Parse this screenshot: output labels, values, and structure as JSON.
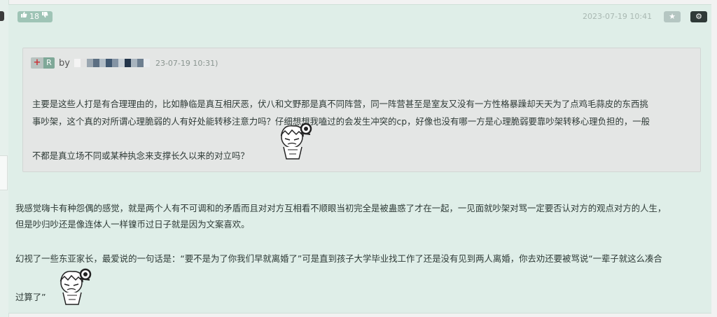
{
  "post": {
    "vote_count": "18",
    "icons": {
      "upvote": "thumb-up-icon",
      "downvote": "thumb-down-icon",
      "favorite": "star-icon",
      "settings": "gear-icon"
    },
    "time": "2023-07-19 10:41",
    "favorite_symbol": "★",
    "settings_symbol": "⚙"
  },
  "quote": {
    "plus_label": "+",
    "r_label": "R",
    "by_label": "by",
    "date_fragment": "23-07-19 10:31)",
    "mosaic_colors": [
      "#f4f4f4",
      "#e2e2e2",
      "#9aa6b0",
      "#5c6f82",
      "#b0bcc6",
      "#3f5770",
      "#8494a4",
      "#c8d0d6",
      "#23354a",
      "#a8b4be",
      "#6d7f90",
      "#e9ecef"
    ],
    "lines": [
      "主要是这些人打是有合理理由的，比如静临是真互相厌恶，伏八和文野那是真不同阵营，同一阵营甚至是室友又没有一方性格暴躁却天天为了点鸡毛蒜皮的东西挑",
      "事吵架，这个真的对所谓心理脆弱的人有好处能转移注意力吗？仔细想想我嗑过的会发生冲突的cp，好像也没有哪一方是心理脆弱要靠吵架转移心理负担的，一般",
      "不都是真立场不同或某种执念来支撑长久以来的对立吗？"
    ]
  },
  "body": {
    "para1_lines": [
      "我感觉嗨卡有种怨偶的感觉，就是两个人有不可调和的矛盾而且对对方互相看不顺眼当初完全是被蛊惑了才在一起，一见面就吵架对骂一定要否认对方的观点对方的人生，",
      "但是吵归吵还是像连体人一样镍币过日子就是因为文案喜欢。"
    ],
    "para2_lines": [
      "幻视了一些东亚家长，最爱说的一句话是：“要不是为了你我们早就离婚了”可是直到孩子大学毕业找工作了还是没有见到两人离婚，你去劝还要被骂说“一辈子就这么凑合",
      "过算了”"
    ]
  }
}
